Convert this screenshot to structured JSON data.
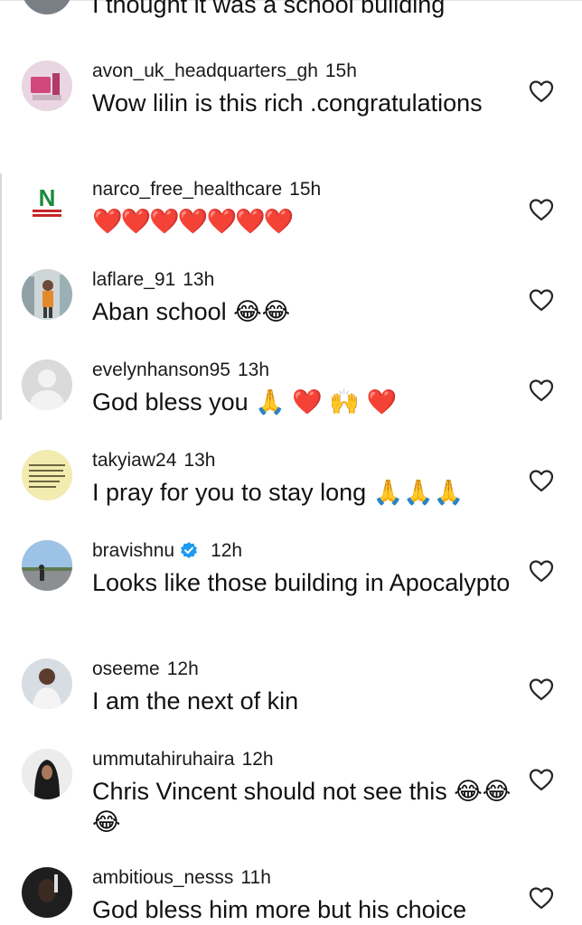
{
  "top_partial": {
    "text": "I thought it was a school building"
  },
  "comments": [
    {
      "username": "avon_uk_headquarters_gh",
      "time": "15h",
      "text": "Wow lilin is this rich .congratulations"
    },
    {
      "username": "narco_free_healthcare",
      "time": "15h",
      "text": "❤️❤️❤️❤️❤️❤️❤️"
    },
    {
      "username": "laflare_91",
      "time": "13h",
      "text": "Aban school 😂😂"
    },
    {
      "username": "evelynhanson95",
      "time": "13h",
      "text": "God bless you 🙏 ❤️ 🙌 ❤️"
    },
    {
      "username": "takyiaw24",
      "time": "13h",
      "text": "I pray for you to stay long 🙏🙏🙏"
    },
    {
      "username": "bravishnu",
      "time": "12h",
      "text": "Looks like those building in Apocalypto",
      "verified": true
    },
    {
      "username": "oseeme",
      "time": "12h",
      "text": "I am the next of kin"
    },
    {
      "username": "ummutahiruhaira",
      "time": "12h",
      "text": "Chris Vincent should not see this 😂😂😂"
    },
    {
      "username": "ambitious_nesss",
      "time": "11h",
      "text": "God bless him more but his choice"
    }
  ],
  "avatar_logo_text": {
    "letter": "N",
    "caption": "NARCO FREE HEALTHCARE"
  },
  "colors": {
    "verified": "#1d9bf0",
    "text": "#111111",
    "heart_outline": "#262626"
  },
  "icons": {
    "like": "heart-outline-icon",
    "verified": "verified-badge-icon"
  }
}
